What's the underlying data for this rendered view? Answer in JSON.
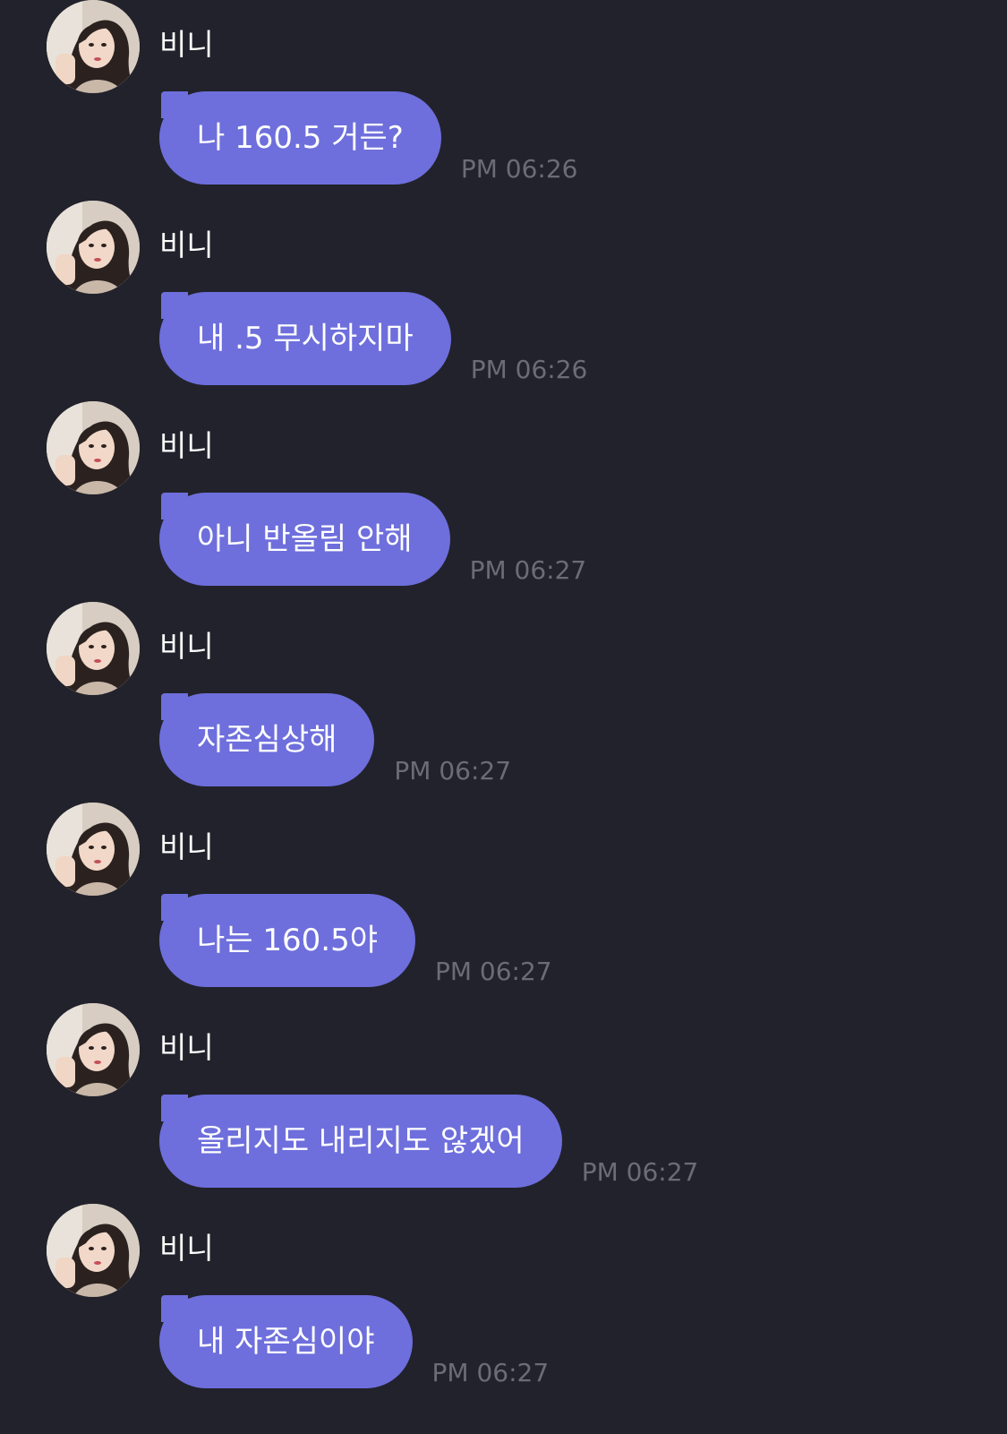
{
  "messages": [
    {
      "sender": "비니",
      "text": "나 160.5 거든?",
      "time": "PM 06:26"
    },
    {
      "sender": "비니",
      "text": "내 .5 무시하지마",
      "time": "PM 06:26"
    },
    {
      "sender": "비니",
      "text": "아니 반올림 안해",
      "time": "PM 06:27"
    },
    {
      "sender": "비니",
      "text": "자존심상해",
      "time": "PM 06:27"
    },
    {
      "sender": "비니",
      "text": "나는 160.5야",
      "time": "PM 06:27"
    },
    {
      "sender": "비니",
      "text": "올리지도 내리지도 않겠어",
      "time": "PM 06:27"
    },
    {
      "sender": "비니",
      "text": "내 자존심이야",
      "time": "PM 06:27"
    }
  ],
  "colors": {
    "background": "#22222c",
    "bubble": "#6e6fdc",
    "timestamp": "#6b6c78"
  }
}
